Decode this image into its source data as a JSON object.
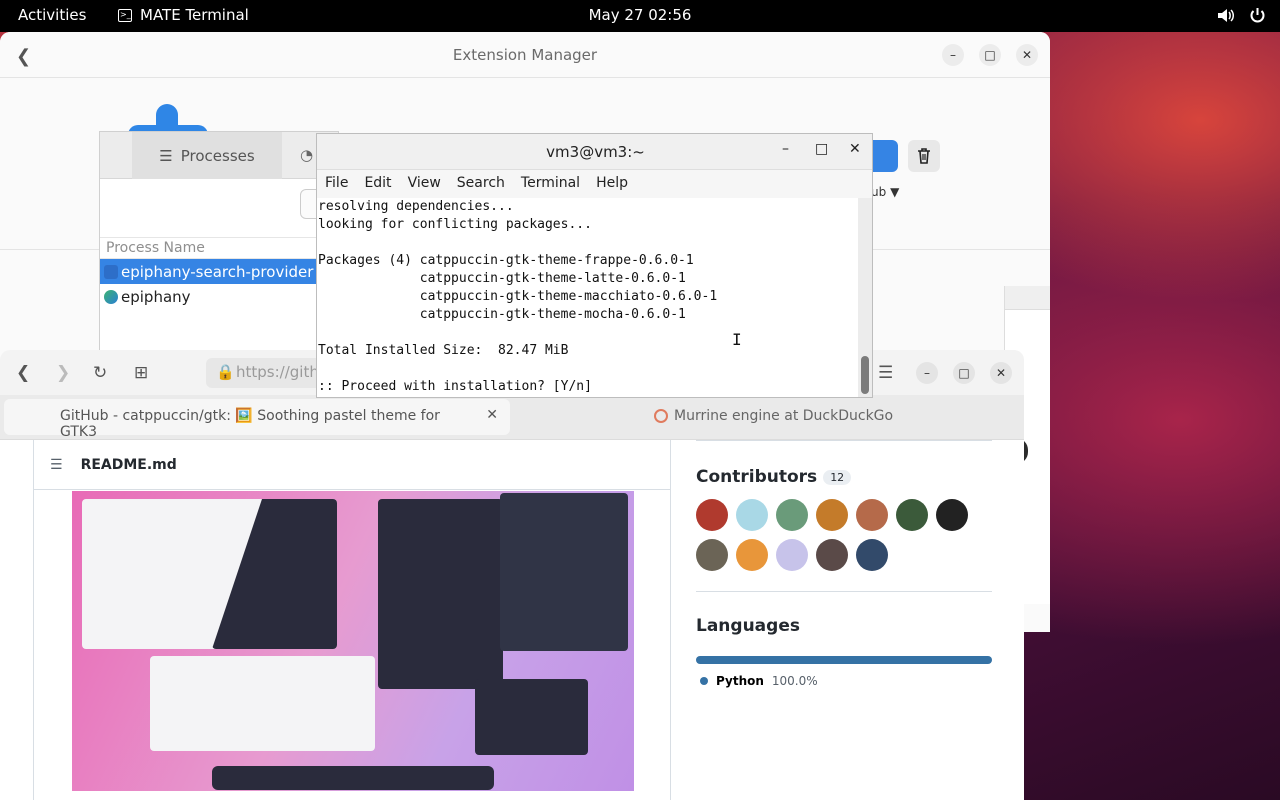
{
  "topbar": {
    "activities": "Activities",
    "app_name": "MATE Terminal",
    "clock": "May 27  02:56"
  },
  "extension_manager": {
    "title": "Extension Manager",
    "hub_label": "ub"
  },
  "system_monitor": {
    "tab_processes": "Processes",
    "column_process_name": "Process Name",
    "processes": [
      "epiphany-search-provider",
      "epiphany"
    ]
  },
  "terminal": {
    "title": "vm3@vm3:~",
    "menu": [
      "File",
      "Edit",
      "View",
      "Search",
      "Terminal",
      "Help"
    ],
    "lines": [
      "resolving dependencies...",
      "looking for conflicting packages...",
      "",
      "Packages (4) catppuccin-gtk-theme-frappe-0.6.0-1",
      "             catppuccin-gtk-theme-latte-0.6.0-1",
      "             catppuccin-gtk-theme-macchiato-0.6.0-1",
      "             catppuccin-gtk-theme-mocha-0.6.0-1",
      "",
      "Total Installed Size:  82.47 MiB",
      "",
      ":: Proceed with installation? [Y/n]"
    ]
  },
  "browser": {
    "url_text": "https://githu",
    "tab_active": "GitHub - catppuccin/gtk: 🖼️ Soothing pastel theme for GTK3",
    "tab_inactive": "Murrine engine at DuckDuckGo",
    "readme_title": "README.md",
    "contributors_title": "Contributors",
    "contributors_count": "12",
    "languages_title": "Languages",
    "language_name": "Python",
    "language_percent": "100.0%",
    "language_fraction": 1.0,
    "language_color": "#3572a5",
    "avatar_colors": [
      "#b03a2e",
      "#a9d8e6",
      "#6a9b7a",
      "#c47b2a",
      "#b56a4a",
      "#3b5a3a",
      "#222222",
      "#6b6456",
      "#e8963a",
      "#c7c3ea",
      "#5a4a48",
      "#324a6a"
    ]
  },
  "colors": {
    "accent": "#3584e4",
    "topbar": "#000000"
  }
}
